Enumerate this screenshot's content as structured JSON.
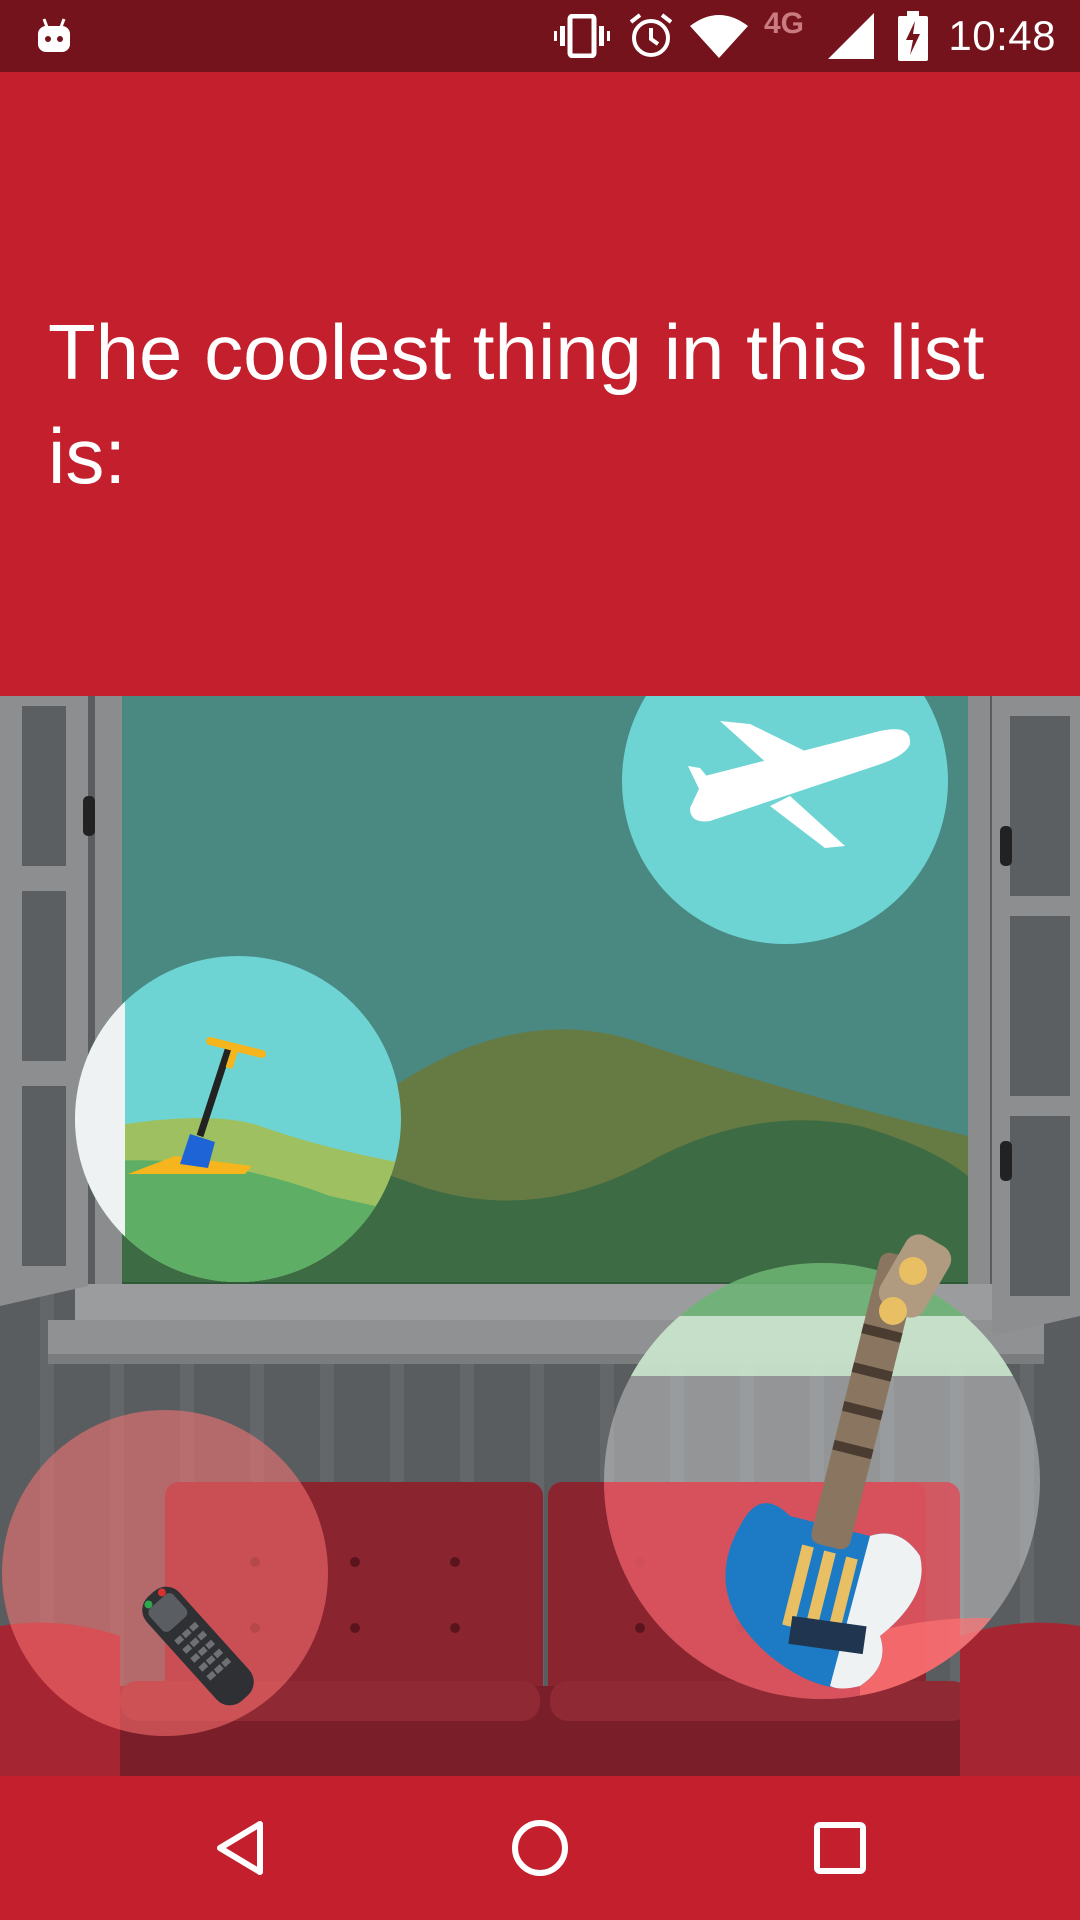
{
  "status_bar": {
    "network_label": "4G",
    "time": "10:48",
    "icons": [
      "android-notification-icon",
      "vibrate-icon",
      "alarm-icon",
      "wifi-icon",
      "signal-icon",
      "battery-charging-icon"
    ]
  },
  "question": {
    "text": "The coolest thing in this list is:"
  },
  "options": [
    {
      "name": "airplane",
      "icon": "airplane-icon"
    },
    {
      "name": "shovel",
      "icon": "shovel-icon"
    },
    {
      "name": "tv-remote",
      "icon": "tv-remote-icon"
    },
    {
      "name": "guitar",
      "icon": "guitar-icon"
    }
  ],
  "navigation": {
    "buttons": [
      "back",
      "home",
      "recents"
    ]
  },
  "colors": {
    "primary": "#c41f2c",
    "status_bar": "#74131b",
    "sky": "#4a8882",
    "bubble": "#6dd4d3"
  }
}
